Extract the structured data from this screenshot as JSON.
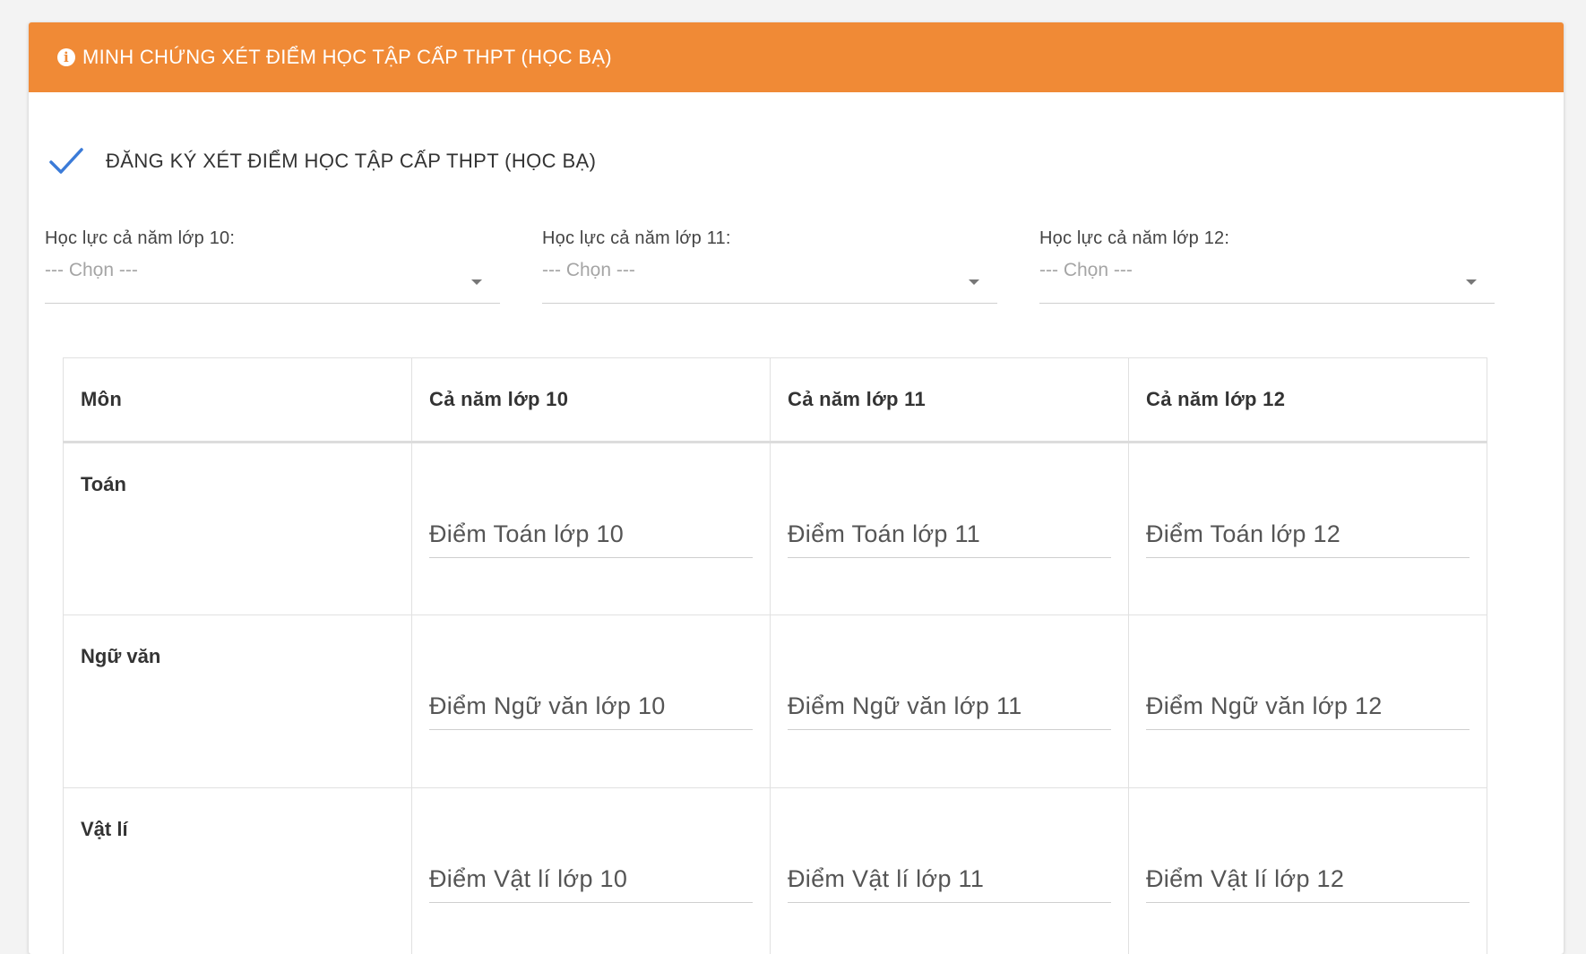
{
  "header": {
    "title": "MINH CHỨNG XÉT ĐIỂM HỌC TẬP CẤP THPT (HỌC BẠ)",
    "icon": "info-icon",
    "color": "#f08a36"
  },
  "register": {
    "checked": true,
    "label": "ĐĂNG KÝ XÉT ĐIỂM HỌC TẬP CẤP THPT (HỌC BẠ)",
    "check_color": "#3b7bd8"
  },
  "selects": [
    {
      "label": "Học lực cả năm lớp 10:",
      "value": "--- Chọn ---"
    },
    {
      "label": "Học lực cả năm lớp 11:",
      "value": "--- Chọn ---"
    },
    {
      "label": "Học lực cả năm lớp 12:",
      "value": "--- Chọn ---"
    }
  ],
  "table": {
    "headers": [
      "Môn",
      "Cả năm lớp 10",
      "Cả năm lớp 11",
      "Cả năm lớp 12"
    ],
    "rows": [
      {
        "subject": "Toán",
        "placeholders": [
          "Điểm Toán lớp 10",
          "Điểm Toán lớp 11",
          "Điểm Toán lớp 12"
        ]
      },
      {
        "subject": "Ngữ văn",
        "placeholders": [
          "Điểm Ngữ văn lớp 10",
          "Điểm Ngữ văn lớp 11",
          "Điểm Ngữ văn lớp 12"
        ]
      },
      {
        "subject": "Vật lí",
        "placeholders": [
          "Điểm Vật lí lớp 10",
          "Điểm Vật lí lớp 11",
          "Điểm Vật lí lớp 12"
        ]
      }
    ]
  }
}
